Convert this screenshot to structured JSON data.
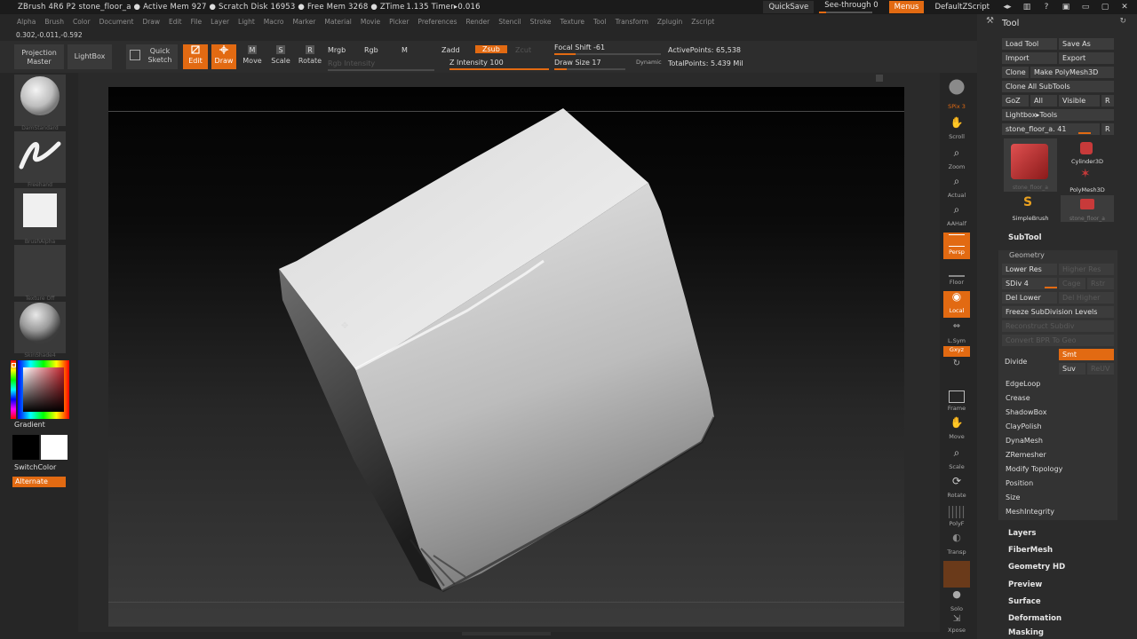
{
  "titlebar": {
    "info": "ZBrush 4R6 P2    stone_floor_a    ● Active Mem 927 ● Scratch Disk 16953 ● Free Mem 3268 ● ZTime 1.135 Timer▸0.016",
    "quicksave": "QuickSave",
    "see_through": "See-through  0",
    "menus": "Menus",
    "script": "DefaultZScript"
  },
  "menubar": {
    "items": [
      "Alpha",
      "Brush",
      "Color",
      "Document",
      "Draw",
      "Edit",
      "File",
      "Layer",
      "Light",
      "Macro",
      "Marker",
      "Material",
      "Movie",
      "Picker",
      "Preferences",
      "Render",
      "Stencil",
      "Stroke",
      "Texture",
      "Tool",
      "Transform",
      "Zplugin",
      "Zscript"
    ]
  },
  "coords": "0.302,-0.011,-0.592",
  "toolbar": {
    "projection_master": "Projection Master",
    "lightbox": "LightBox",
    "quick_sketch": "Quick Sketch",
    "edit": "Edit",
    "draw": "Draw",
    "move": "Move",
    "scale": "Scale",
    "rotate": "Rotate",
    "mrgb": "Mrgb",
    "rgb": "Rgb",
    "m": "M",
    "rgb_intensity": "Rgb  Intensity",
    "zadd": "Zadd",
    "zsub": "Zsub",
    "zcut": "Zcut",
    "z_intensity": "Z Intensity 100",
    "focal_shift": "Focal Shift -61",
    "draw_size": "Draw Size 17",
    "dynamic": "Dynamic",
    "active_points": "ActivePoints: 65,538",
    "total_points": "TotalPoints: 5.439 Mil"
  },
  "leftshelf": {
    "brush_label": "DamStandard",
    "stroke_label": "Freehand",
    "alpha_label": "BrushAlpha",
    "texture_label": "Texture Off",
    "material_label": "SkinShade4",
    "gradient": "Gradient",
    "switch_color": "SwitchColor",
    "alternate": "Alternate"
  },
  "rightshelf": {
    "buttons": [
      "BPR",
      "SPix 3",
      "Scroll",
      "Zoom",
      "Actual",
      "AAHalf",
      "Persp",
      "Floor",
      "Local",
      "L.Sym",
      "Gxyz",
      "Frame",
      "Move",
      "Scale",
      "Rotate",
      "PolyF",
      "Transp",
      "Ghost",
      "Solo",
      "Xpose"
    ]
  },
  "palette": {
    "title": "Tool",
    "load_tool": "Load Tool",
    "save_as": "Save As",
    "import": "Import",
    "export": "Export",
    "clone": "Clone",
    "make_polymesh": "Make PolyMesh3D",
    "clone_all": "Clone  All SubTools",
    "goz": "GoZ",
    "all": "All",
    "visible": "Visible",
    "r": "R",
    "lightbox_tools": "Lightbox▸Tools",
    "current_tool": "stone_floor_a. 41",
    "thumbs": [
      "stone_floor_a",
      "Cylinder3D",
      "PolyMesh3D",
      "SimpleBrush",
      "stone_floor_a"
    ],
    "subtool": "SubTool",
    "geometry": "Geometry",
    "lower_res": "Lower Res",
    "higher_res": "Higher Res",
    "sdiv": "SDiv 4",
    "cage": "Cage",
    "rstr": "Rstr",
    "del_lower": "Del Lower",
    "del_higher": "Del Higher",
    "freeze": "Freeze SubDivision Levels",
    "reconstruct": "Reconstruct Subdiv",
    "convert_bpr": "Convert BPR To Geo",
    "divide": "Divide",
    "smt": "Smt",
    "suv": "Suv",
    "reuv": "ReUV",
    "sub_items": [
      "EdgeLoop",
      "Crease",
      "ShadowBox",
      "ClayPolish",
      "DynaMesh",
      "ZRemesher",
      "Modify Topology",
      "Position",
      "Size",
      "MeshIntegrity"
    ],
    "sections": [
      "Layers",
      "FiberMesh",
      "Geometry HD",
      "Preview",
      "Surface",
      "Deformation",
      "Masking"
    ]
  },
  "colors": {
    "accent": "#e26a12",
    "panel": "#2b2b2b",
    "canvas_top": "#020202",
    "canvas_bottom": "#3b3b3b"
  }
}
